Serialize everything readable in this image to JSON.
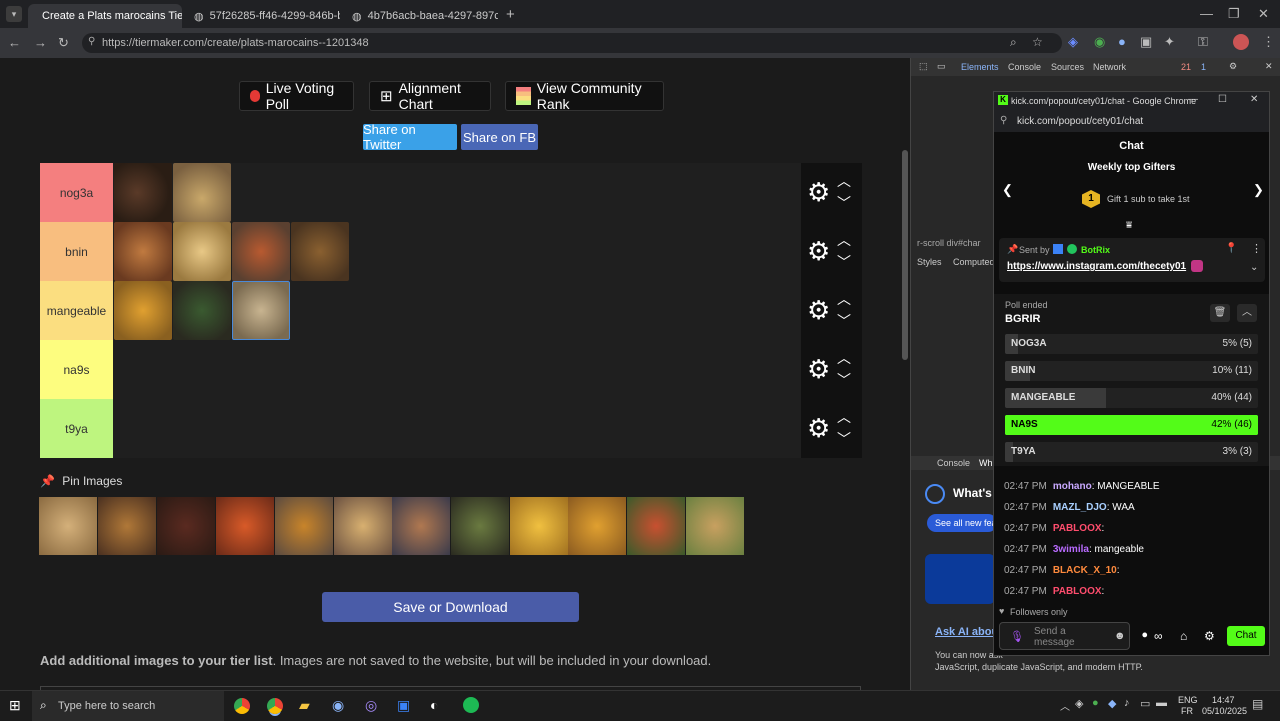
{
  "browser": {
    "tabs": [
      {
        "label": "Create a Plats marocains Tier Li"
      },
      {
        "label": "57f26285-ff46-4299-846b-b8e"
      },
      {
        "label": "4b7b6acb-baea-4297-897c-1e"
      }
    ],
    "url": "https://tiermaker.com/create/plats-marocains--1201348"
  },
  "page": {
    "buttons": {
      "live_voting": "Live Voting Poll",
      "alignment": "Alignment Chart",
      "community": "View Community Rank",
      "twitter": "Share on Twitter",
      "fb": "Share on FB",
      "save": "Save or Download"
    },
    "tiers": [
      {
        "label": "nog3a",
        "color": "#f47f7f"
      },
      {
        "label": "bnin",
        "color": "#f8be7f"
      },
      {
        "label": "mangeable",
        "color": "#fbde80"
      },
      {
        "label": "na9s",
        "color": "#fdfd7f"
      },
      {
        "label": "t9ya",
        "color": "#bef57f"
      }
    ],
    "pin_label": "Pin Images",
    "add_images_bold": "Add additional images to your tier list",
    "add_images_rest": ". Images are not saved to the website, but will be included in your download."
  },
  "devtools": {
    "tabs": [
      "Elements",
      "Console",
      "Sources",
      "Network"
    ],
    "errors": "21",
    "warnings": "1",
    "subtabs": [
      "Styles",
      "Computed"
    ],
    "breadcrumb": "r-scroll   div#char",
    "bottom_tabs": [
      "Console",
      "Wh"
    ],
    "whats_new": "What's n",
    "see_all": "See all new feat",
    "ai_link": "Ask AI about",
    "ai_text_1": "You can now ask",
    "ai_text_2": "JavaScript, duplicate JavaScript, and modern HTTP."
  },
  "chat": {
    "window_title": "kick.com/popout/cety01/chat - Google Chrome",
    "url": "kick.com/popout/cety01/chat",
    "header": "Chat",
    "gifters_title": "Weekly top Gifters",
    "gift_text": "Gift 1 sub to take 1st",
    "gift_rank": "1",
    "sent_by_prefix": "Sent by",
    "sent_by_user": "BotRix",
    "pinned_link": "https://www.instagram.com/thecety01",
    "poll_status": "Poll ended",
    "poll_title": "BGRIR",
    "poll_options": [
      {
        "label": "NOG3A",
        "pct": 5,
        "display": "5% (5)"
      },
      {
        "label": "BNIN",
        "pct": 10,
        "display": "10% (11)"
      },
      {
        "label": "MANGEABLE",
        "pct": 40,
        "display": "40% (44)"
      },
      {
        "label": "NA9S",
        "pct": 42,
        "display": "42% (46)",
        "winner": true
      },
      {
        "label": "T9YA",
        "pct": 3,
        "display": "3% (3)"
      }
    ],
    "messages": [
      {
        "time": "02:47 PM",
        "user": "mohano",
        "user_color": "#c9a9ff",
        "text": ": MANGEABLE"
      },
      {
        "time": "02:47 PM",
        "user": "MAZL_DJO",
        "user_color": "#a9d0ff",
        "text": ": WAA"
      },
      {
        "time": "02:47 PM",
        "user": "PABLOOX",
        "user_color": "#ff4d6d",
        "text": ":"
      },
      {
        "time": "02:47 PM",
        "user": "3wimila",
        "user_color": "#b96bff",
        "text": ": mangeable"
      },
      {
        "time": "02:47 PM",
        "user": "BLACK_X_10",
        "user_color": "#ff8a3d",
        "text": ":"
      },
      {
        "time": "02:47 PM",
        "user": "PABLOOX",
        "user_color": "#ff4d6d",
        "text": ":"
      }
    ],
    "followers_only": "Followers only",
    "input_placeholder": "Send a message",
    "chat_button": "Chat"
  },
  "taskbar": {
    "search_placeholder": "Type here to search",
    "lang_1": "ENG",
    "lang_2": "FR",
    "time": "14:47",
    "date": "05/10/2025"
  }
}
